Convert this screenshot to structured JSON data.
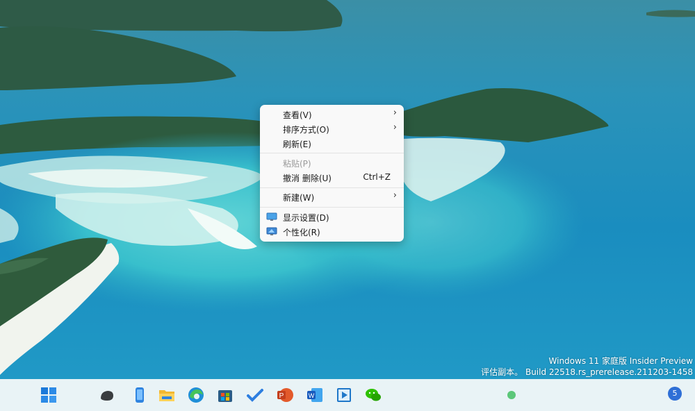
{
  "context_menu": {
    "items": [
      {
        "label": "查看(V)",
        "submenu": true,
        "enabled": true
      },
      {
        "label": "排序方式(O)",
        "submenu": true,
        "enabled": true
      },
      {
        "label": "刷新(E)",
        "enabled": true
      },
      {
        "label": "粘贴(P)",
        "enabled": false
      },
      {
        "label": "撤消 删除(U)",
        "shortcut": "Ctrl+Z",
        "enabled": true
      },
      {
        "label": "新建(W)",
        "submenu": true,
        "enabled": true
      },
      {
        "label": "显示设置(D)",
        "icon": "display-settings-icon",
        "enabled": true
      },
      {
        "label": "个性化(R)",
        "icon": "personalize-icon",
        "enabled": true
      }
    ],
    "submenu_arrow": "›"
  },
  "watermark": {
    "line1": "Windows 11 家庭版 Insider Preview",
    "line2": "评估副本。 Build 22518.rs_prerelease.211203-1458"
  },
  "taskbar": {
    "apps": [
      {
        "name": "start-icon"
      },
      {
        "name": "app-dark-icon"
      },
      {
        "name": "phone-link-icon"
      },
      {
        "name": "file-explorer-icon"
      },
      {
        "name": "edge-icon"
      },
      {
        "name": "microsoft-store-icon"
      },
      {
        "name": "todo-icon"
      },
      {
        "name": "powerpoint-icon"
      },
      {
        "name": "word-icon"
      },
      {
        "name": "media-player-icon"
      },
      {
        "name": "wechat-icon"
      }
    ],
    "notification_count": "5"
  },
  "colors": {
    "menu_bg": "#f9f9f9",
    "taskbar_bg": "#e9f3f6",
    "accent": "#2f6fd6"
  }
}
